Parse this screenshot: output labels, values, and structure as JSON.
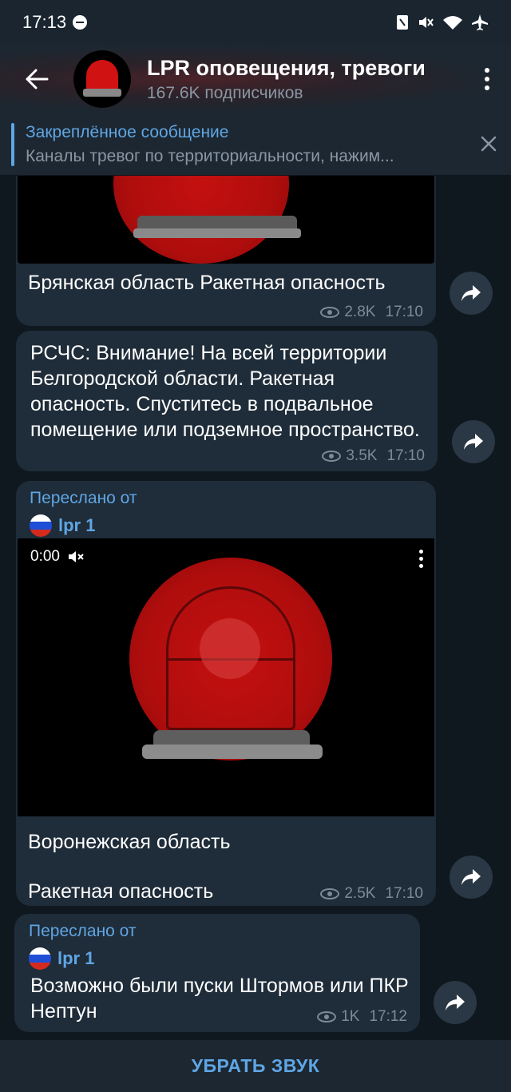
{
  "status_bar": {
    "time": "17:13",
    "icons": [
      "dnd-icon",
      "nfc-icon",
      "mute-icon",
      "wifi-icon",
      "airplane-icon"
    ]
  },
  "header": {
    "title": "LPR оповещения, тревоги",
    "subscribers": "167.6K подписчиков"
  },
  "pinned": {
    "label": "Закреплённое сообщение",
    "preview": "Каналы тревог по территориальности, нажим..."
  },
  "messages": [
    {
      "text": "Брянская область Ракетная опасность",
      "views": "2.8K",
      "time": "17:10"
    },
    {
      "text": "РСЧС: Внимание!  На всей территории Белгородской области. Ракетная опасность. Спуститесь в подвальное помещение или подземное пространство.",
      "views": "3.5K",
      "time": "17:10"
    },
    {
      "forwarded_label": "Переслано от",
      "forwarded_from": "lpr 1",
      "video_time": "0:00",
      "text_line1": "Воронежская область",
      "text_line2": "Ракетная опасность",
      "views": "2.5K",
      "time": "17:10"
    },
    {
      "forwarded_label": "Переслано от",
      "forwarded_from": "lpr 1",
      "text": "Возможно были пуски Штормов или ПКР Нептун",
      "views": "1K",
      "time": "17:12"
    }
  ],
  "bottom": {
    "mute_label": "УБРАТЬ ЗВУК"
  },
  "colors": {
    "accent": "#5fa6e4",
    "bubble": "#1f2c39",
    "background": "#0f171f"
  }
}
